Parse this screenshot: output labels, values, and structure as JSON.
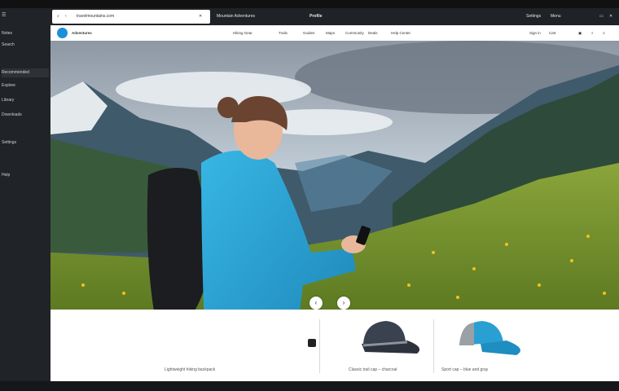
{
  "top_bar": {
    "color": "#111111"
  },
  "left_rail": {
    "items": [
      {
        "label": "☰",
        "icon": "menu-icon"
      },
      {
        "label": "Notes"
      },
      {
        "label": "Search"
      },
      {
        "label": ""
      },
      {
        "label": "Recommended"
      },
      {
        "label": "Explore"
      },
      {
        "label": "Library"
      },
      {
        "label": "Downloads"
      },
      {
        "label": "Settings"
      },
      {
        "label": "Help"
      }
    ]
  },
  "browser": {
    "tab_url": "travelmountains.com",
    "tab_title": "Mountain Adventures",
    "window_labels": [
      "Profile",
      "Settings",
      "Menu"
    ]
  },
  "site_nav": {
    "brand": "Adventures",
    "links": [
      "Hiking Gear",
      "Trails",
      "Guides",
      "Maps",
      "Community",
      "Deals",
      "Help Center"
    ],
    "right_labels": [
      "Sign in",
      "Cart"
    ]
  },
  "hero": {
    "alt": "Smiling hiker in a blue puffer jacket with a backpack holding a phone in a mountain valley",
    "prev_label": "‹",
    "next_label": "›"
  },
  "products": [
    {
      "caption": "Lightweight hiking backpack",
      "icon": "backpack-icon"
    },
    {
      "caption": "Classic trail cap – charcoal",
      "icon": "cap-icon"
    },
    {
      "caption": "Sport cap – blue and gray",
      "icon": "cap-icon"
    }
  ],
  "colors": {
    "accent": "#1d8fd8",
    "jacket": "#2aa7d8",
    "sidebar": "#202327",
    "meadow": "#7f9a2e"
  }
}
